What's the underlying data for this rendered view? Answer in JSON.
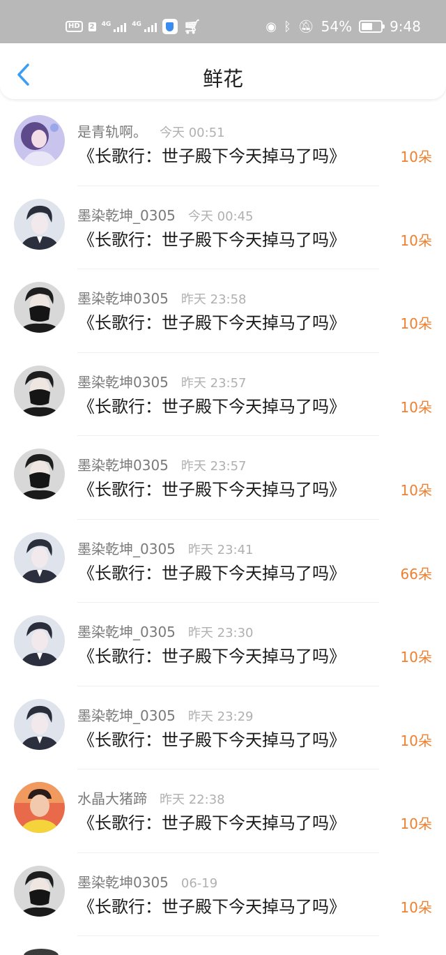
{
  "status_bar": {
    "hd": "HD",
    "sim": "2",
    "net1": "4G",
    "net2": "4G",
    "battery_percent": "54%",
    "battery_level": 0.54,
    "time": "9:48",
    "icons": [
      "shield-icon",
      "cart-icon",
      "eye-icon",
      "bluetooth-icon",
      "mute-bell-icon",
      "battery-icon"
    ]
  },
  "nav": {
    "title": "鲜花",
    "back_icon": "chevron-left-icon",
    "accent_color": "#3b9ef5"
  },
  "colors": {
    "amount": "#f07f2e",
    "status_bar_bg": "#b8b8b8"
  },
  "items": [
    {
      "username": "是青轨啊。",
      "time": "今天 00:51",
      "book": "《长歌行：世子殿下今天掉马了吗》",
      "amount": "10朵",
      "avatar": "avatar-girl-purple"
    },
    {
      "username": "墨染乾坤_0305",
      "time": "今天 00:45",
      "book": "《长歌行：世子殿下今天掉马了吗》",
      "amount": "10朵",
      "avatar": "avatar-man-suit"
    },
    {
      "username": "墨染乾坤0305",
      "time": "昨天 23:58",
      "book": "《长歌行：世子殿下今天掉马了吗》",
      "amount": "10朵",
      "avatar": "avatar-man-mask"
    },
    {
      "username": "墨染乾坤0305",
      "time": "昨天 23:57",
      "book": "《长歌行：世子殿下今天掉马了吗》",
      "amount": "10朵",
      "avatar": "avatar-man-mask"
    },
    {
      "username": "墨染乾坤0305",
      "time": "昨天 23:57",
      "book": "《长歌行：世子殿下今天掉马了吗》",
      "amount": "10朵",
      "avatar": "avatar-man-mask"
    },
    {
      "username": "墨染乾坤_0305",
      "time": "昨天 23:41",
      "book": "《长歌行：世子殿下今天掉马了吗》",
      "amount": "66朵",
      "avatar": "avatar-man-suit"
    },
    {
      "username": "墨染乾坤_0305",
      "time": "昨天 23:30",
      "book": "《长歌行：世子殿下今天掉马了吗》",
      "amount": "10朵",
      "avatar": "avatar-man-suit"
    },
    {
      "username": "墨染乾坤_0305",
      "time": "昨天 23:29",
      "book": "《长歌行：世子殿下今天掉马了吗》",
      "amount": "10朵",
      "avatar": "avatar-man-suit"
    },
    {
      "username": "水晶大猪蹄",
      "time": "昨天 22:38",
      "book": "《长歌行：世子殿下今天掉马了吗》",
      "amount": "10朵",
      "avatar": "avatar-man-yellow"
    },
    {
      "username": "墨染乾坤0305",
      "time": "06-19",
      "book": "《长歌行：世子殿下今天掉马了吗》",
      "amount": "10朵",
      "avatar": "avatar-man-mask"
    }
  ]
}
